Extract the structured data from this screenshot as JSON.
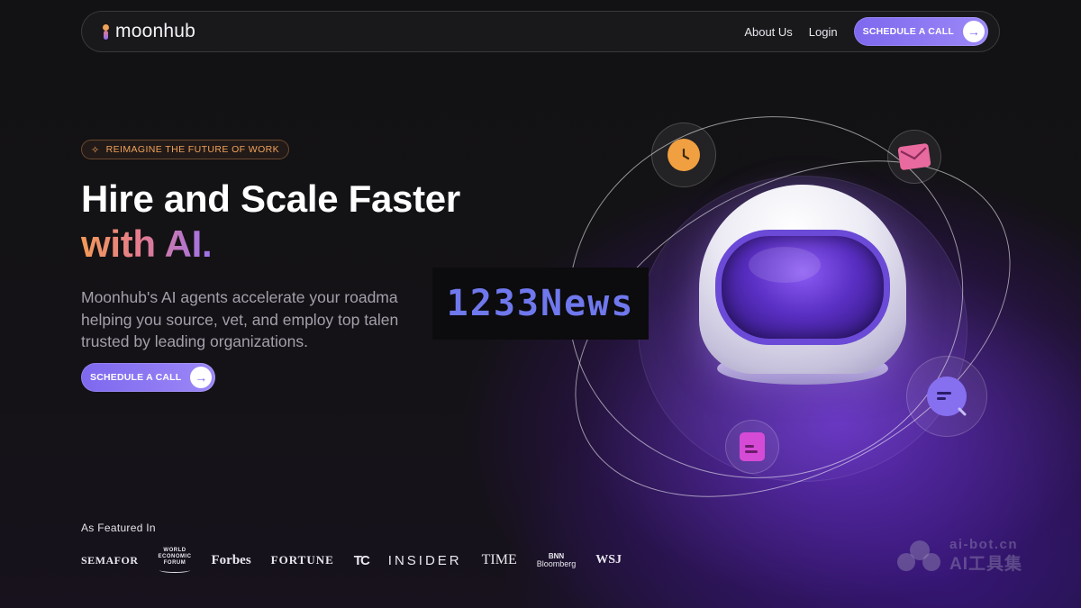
{
  "nav": {
    "logo_text": "moonhub",
    "links": [
      "About Us",
      "Login"
    ],
    "cta_label": "SCHEDULE A CALL"
  },
  "hero": {
    "badge": "REIMAGINE THE FUTURE OF WORK",
    "headline_line1": "Hire and Scale Faster",
    "headline_line2": "with AI.",
    "description_lines": [
      "Moonhub's AI agents accelerate your roadma",
      "helping you source, vet, and employ top talen",
      "trusted by leading organizations."
    ],
    "cta_label": "SCHEDULE A CALL"
  },
  "overlay_text": "1233News",
  "featured": {
    "title": "As Featured In",
    "logos": {
      "semafor": "SEMAFOR",
      "wef": [
        "WORLD",
        "ECONOMIC",
        "FORUM"
      ],
      "forbes": "Forbes",
      "fortune": "FORTUNE",
      "techcrunch": "TC",
      "insider": "INSIDER",
      "time": "TIME",
      "bnn": [
        "BNN",
        "Bloomberg"
      ],
      "wsj": "WSJ"
    }
  },
  "watermark": {
    "line1": "ai-bot.cn",
    "line2": "AI工具集"
  },
  "colors": {
    "accent": "#8a74f2",
    "badge_orange": "#f0a25a",
    "gradient_start": "#f29a56",
    "gradient_mid": "#e57c8e",
    "gradient_end": "#9b72ec"
  },
  "icons": [
    "clock-icon",
    "mail-icon",
    "chat-search-icon",
    "document-icon",
    "astronaut-helmet-illustration"
  ]
}
